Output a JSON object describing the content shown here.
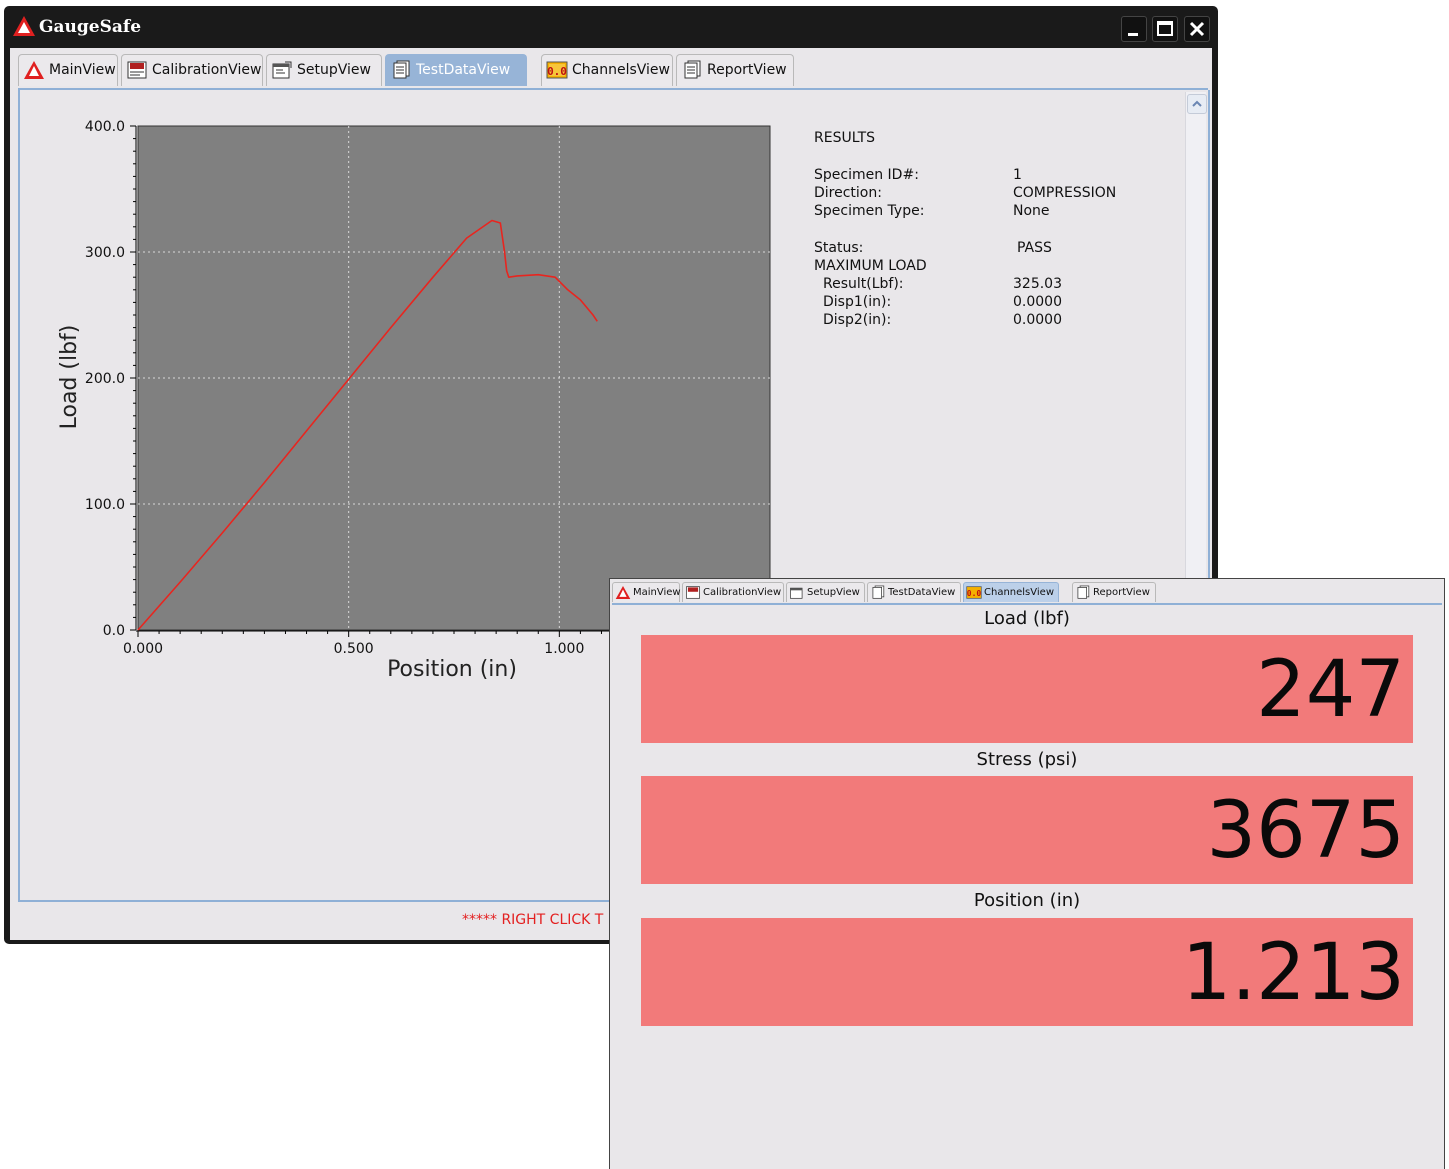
{
  "app": {
    "title": "GaugeSafe",
    "window_controls": [
      "minimize-icon",
      "maximize-icon",
      "close-icon"
    ]
  },
  "tabs": [
    {
      "label": "MainView",
      "icon": "warning-triangle-icon"
    },
    {
      "label": "CalibrationView",
      "icon": "calibration-chart-icon"
    },
    {
      "label": "SetupView",
      "icon": "setup-dialog-icon"
    },
    {
      "label": "TestDataView",
      "icon": "document-stack-icon",
      "active": true
    },
    {
      "label": "ChannelsView",
      "icon": "digital-readout-icon"
    },
    {
      "label": "ReportView",
      "icon": "report-pages-icon"
    }
  ],
  "chart_data": {
    "type": "line",
    "title": "",
    "xlabel": "Position (in)",
    "ylabel": "Load (lbf)",
    "xlim": [
      0.0,
      1.5
    ],
    "ylim": [
      0.0,
      400.0
    ],
    "x_ticks": [
      "0.000",
      "0.500",
      "1.000"
    ],
    "x_tick_values": [
      0.0,
      0.5,
      1.0
    ],
    "y_ticks": [
      "0.0",
      "100.0",
      "200.0",
      "300.0",
      "400.0"
    ],
    "y_tick_values": [
      0,
      100,
      200,
      300,
      400
    ],
    "grid": true,
    "background": "#808080",
    "series": [
      {
        "color": "#e8251f",
        "x": [
          0.0,
          0.1,
          0.2,
          0.3,
          0.4,
          0.5,
          0.6,
          0.7,
          0.78,
          0.84,
          0.86,
          0.87,
          0.875,
          0.88,
          0.9,
          0.95,
          0.99,
          1.02,
          1.05,
          1.08,
          1.09
        ],
        "y": [
          0,
          38,
          77,
          117,
          158,
          199,
          240,
          280,
          311,
          325,
          323,
          300,
          285,
          280,
          281,
          282,
          280,
          270,
          262,
          250,
          245
        ]
      }
    ]
  },
  "results": {
    "heading": "RESULTS",
    "specimen_id_label": "Specimen ID#:",
    "specimen_id": "1",
    "direction_label": "Direction:",
    "direction": "COMPRESSION",
    "specimen_type_label": "Specimen Type:",
    "specimen_type": "None",
    "status_label": "Status:",
    "status": "PASS",
    "max_load_label": "MAXIMUM LOAD",
    "result_label": "Result(Lbf):",
    "result": "325.03",
    "disp1_label": "Disp1(in):",
    "disp1": "0.0000",
    "disp2_label": "Disp2(in):",
    "disp2": "0.0000"
  },
  "hint": "***** RIGHT CLICK T",
  "channels_window": {
    "tabs": [
      {
        "label": "MainView",
        "icon": "warning-triangle-icon"
      },
      {
        "label": "CalibrationView",
        "icon": "calibration-chart-icon"
      },
      {
        "label": "SetupView",
        "icon": "setup-dialog-icon"
      },
      {
        "label": "TestDataView",
        "icon": "document-stack-icon"
      },
      {
        "label": "ChannelsView",
        "icon": "digital-readout-icon",
        "active": true
      },
      {
        "label": "ReportView",
        "icon": "report-pages-icon"
      }
    ],
    "channels": [
      {
        "label": "Load (lbf)",
        "value": "247"
      },
      {
        "label": "Stress (psi)",
        "value": "3675"
      },
      {
        "label": "Position (in)",
        "value": "1.213"
      }
    ],
    "readout_color": "#f27a7a"
  }
}
